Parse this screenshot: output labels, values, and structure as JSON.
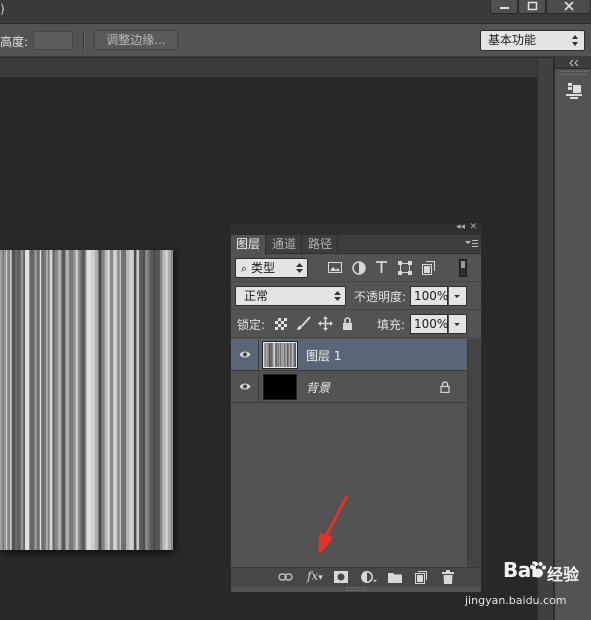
{
  "titlebar": {
    "title_fragment": ")"
  },
  "options_bar": {
    "height_label": "高度:",
    "refine_edge_label": "调整边缘...",
    "workspace_value": "基本功能"
  },
  "layers_panel": {
    "tabs": [
      {
        "label": "图层",
        "active": true
      },
      {
        "label": "通道",
        "active": false
      },
      {
        "label": "路径",
        "active": false
      }
    ],
    "filter_kind": "类型",
    "blend_mode": "正常",
    "opacity_label": "不透明度:",
    "opacity_value": "100%",
    "lock_label": "锁定:",
    "fill_label": "填充:",
    "fill_value": "100%",
    "layers": [
      {
        "name": "图层 1",
        "visible": true,
        "selected": true,
        "locked": false
      },
      {
        "name": "背景",
        "visible": true,
        "selected": false,
        "locked": true
      }
    ],
    "bottom_fx_label": "fx"
  },
  "watermark": {
    "logo_text": "Bai",
    "logo_suffix": "经验",
    "url": "jingyan.baidu.com"
  },
  "colors": {
    "canvas_bg": "#282828",
    "panel_bg": "#535353",
    "selected_layer": "#5a6576",
    "annotation_arrow": "#e8302a"
  }
}
